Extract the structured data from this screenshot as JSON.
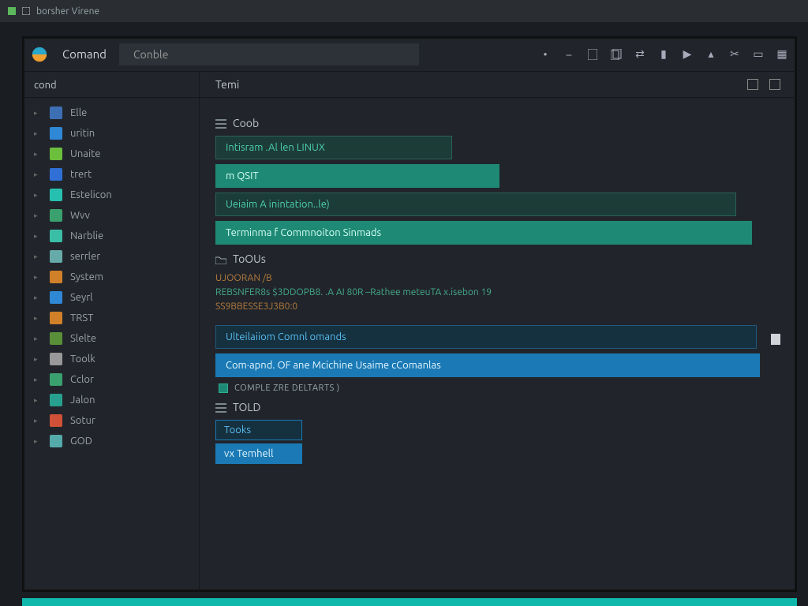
{
  "titlebar": {
    "text": "borsher Virene"
  },
  "toolbar": {
    "title": "Comand",
    "file_tab": "Conble",
    "icons": [
      "dot",
      "dash",
      "doc",
      "docs",
      "arrow",
      "bar",
      "play",
      "cut",
      "scissors",
      "box",
      "boxes"
    ]
  },
  "sidebar": {
    "title": "cond",
    "items": [
      {
        "icon": "#3d6fb5",
        "label": "Elle"
      },
      {
        "icon": "#2f88d6",
        "label": "uritin"
      },
      {
        "icon": "#6cbf3d",
        "label": "Unaite"
      },
      {
        "icon": "#2f6fd6",
        "label": "trert"
      },
      {
        "icon": "#27c0b0",
        "label": "Estelicon"
      },
      {
        "icon": "#3aa06e",
        "label": "Wvv"
      },
      {
        "icon": "#3abfa6",
        "label": "Narblie"
      },
      {
        "icon": "#6aa",
        "label": "serrler"
      },
      {
        "icon": "#d08028",
        "label": "System"
      },
      {
        "icon": "#2f88d6",
        "label": "Seyrl"
      },
      {
        "icon": "#d08028",
        "label": "TRST"
      },
      {
        "icon": "#5a8f3a",
        "label": "Slelte"
      },
      {
        "icon": "#999",
        "label": "Toolk"
      },
      {
        "icon": "#3aa06e",
        "label": "Cclor"
      },
      {
        "icon": "#27a090",
        "label": "Jalon"
      },
      {
        "icon": "#d05038",
        "label": "Sotur"
      },
      {
        "icon": "#5aa",
        "label": "GOD"
      }
    ]
  },
  "main": {
    "header_title": "Temi",
    "sections": {
      "coob": {
        "label": "Coob",
        "items": [
          "Intisram .Al len LINUX",
          "m QSIT",
          "Ueiaim A inintation..le)",
          "Terminma f Commnoiton Sinmads"
        ]
      },
      "tools": {
        "label": "ToOUs",
        "code_line1": "UJOORAN /B",
        "code_line2a": "REBSNFER8s $3DDOPB8. .A AI 80R –Rathee meteuTA x.isebon 19",
        "code_line2b": "SS9BBESSE3J3B0:0",
        "items": [
          "Ulteilaiiom Comnl omands",
          "Com·apnd. OF ane Mcichine Usaime cComanlas"
        ],
        "checkbox_label": "COMPlE zre deltarts )"
      },
      "told": {
        "label": "TOLD",
        "items": [
          "Tooks",
          "vx Temhell"
        ]
      }
    }
  }
}
